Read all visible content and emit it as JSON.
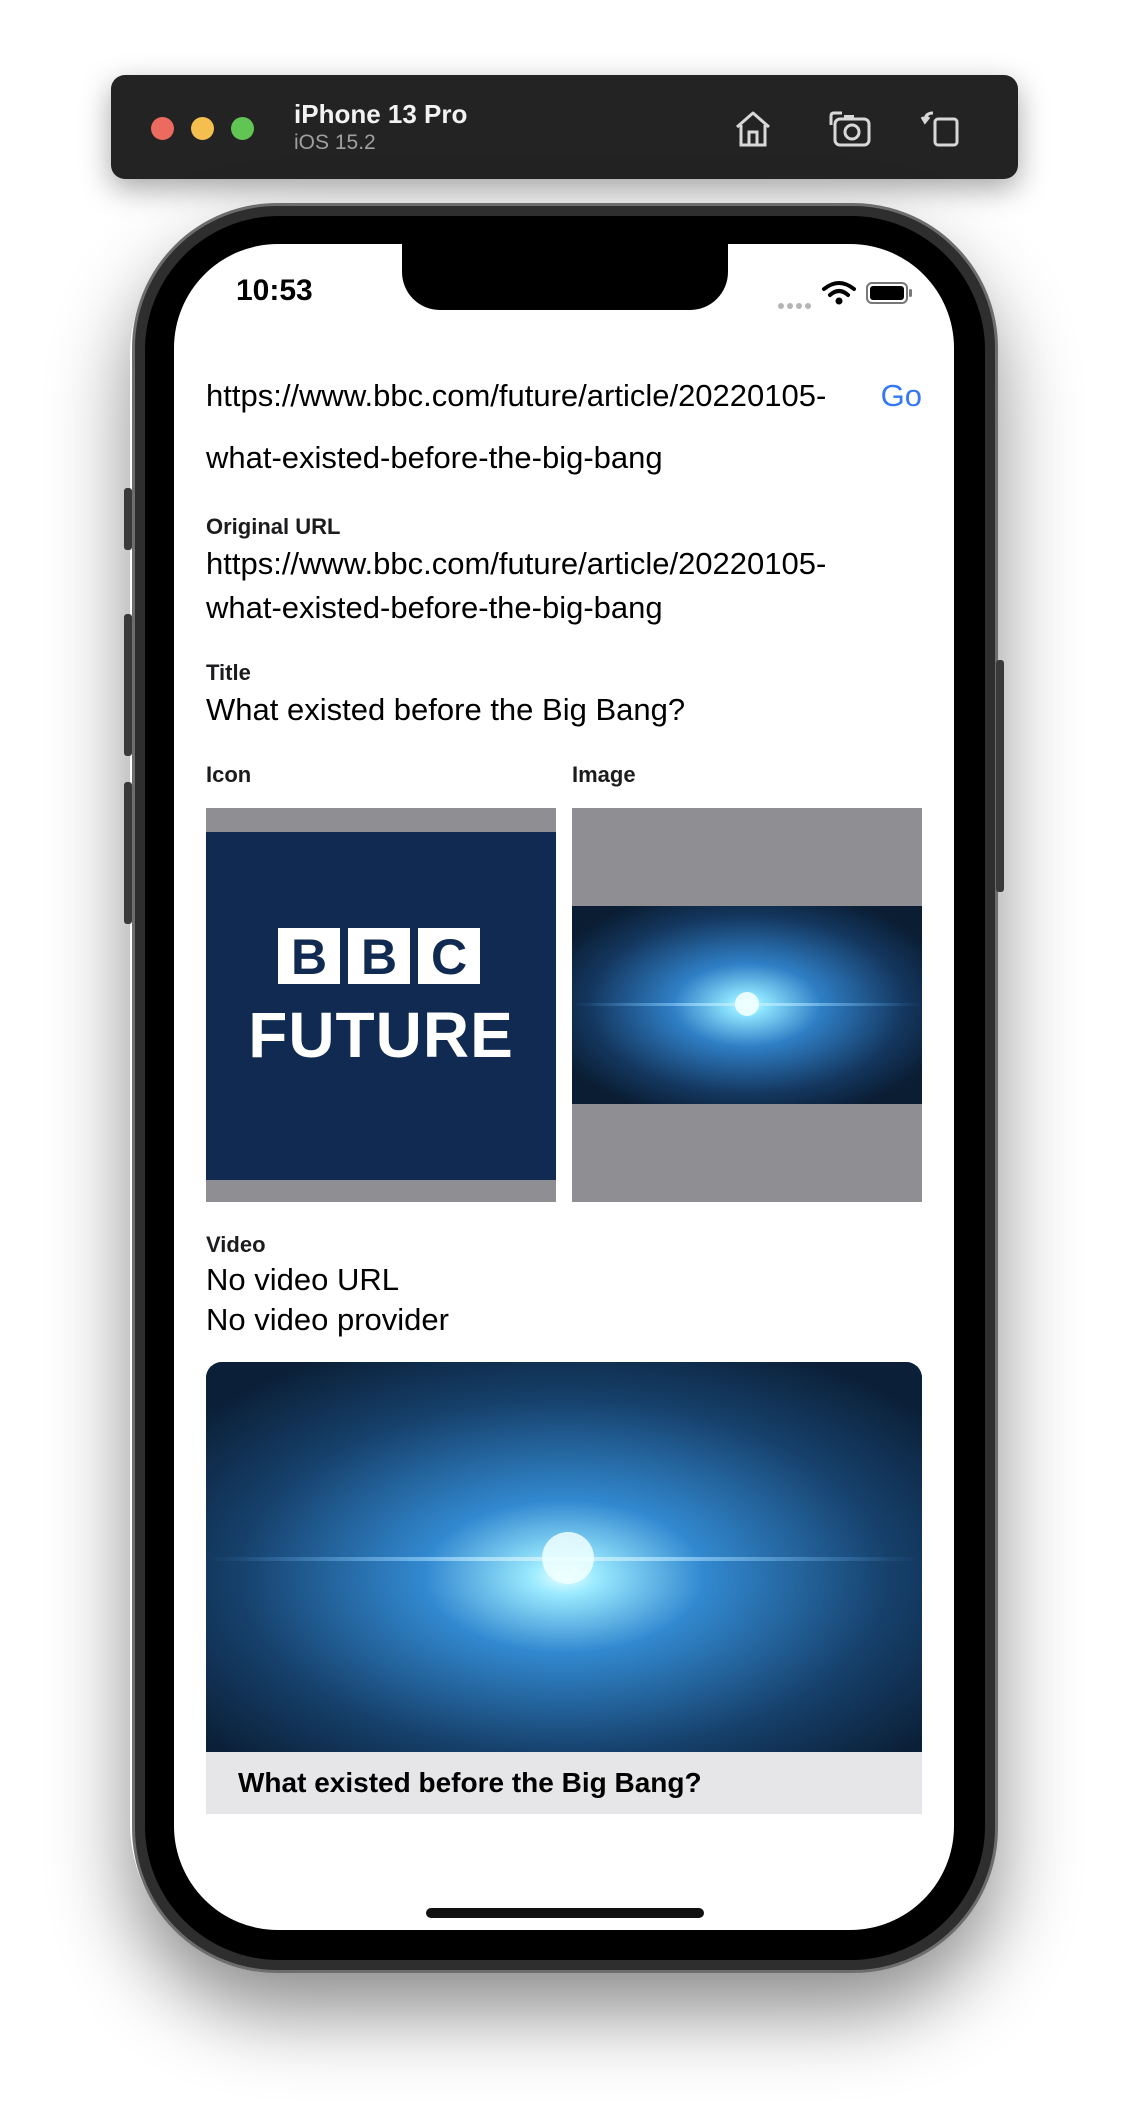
{
  "simulator": {
    "device_name": "iPhone 13 Pro",
    "os_version": "iOS 15.2",
    "home_icon": "home-icon",
    "screenshot_icon": "camera-icon",
    "rotate_icon": "rotate-icon"
  },
  "status_bar": {
    "time": "10:53"
  },
  "url_bar": {
    "value": "https://www.bbc.com/future/article/20220105-",
    "go_label": "Go"
  },
  "slug_line": "what-existed-before-the-big-bang",
  "original_url": {
    "label": "Original URL",
    "line1": "https://www.bbc.com/future/article/20220105-",
    "line2": "what-existed-before-the-big-bang"
  },
  "title": {
    "label": "Title",
    "value": "What existed before the Big Bang?"
  },
  "icon": {
    "label": "Icon",
    "logo_line1": [
      "B",
      "B",
      "C"
    ],
    "logo_line2": "FUTURE"
  },
  "image": {
    "label": "Image"
  },
  "video": {
    "label": "Video",
    "url_status": "No video URL",
    "provider_status": "No video provider"
  },
  "link_preview": {
    "caption": "What existed before the Big Bang?"
  },
  "colors": {
    "accent": "#3478f6",
    "bbc_navy": "#102a52",
    "placeholder_gray": "#8e8e93",
    "caption_bg": "#e6e6e8"
  }
}
